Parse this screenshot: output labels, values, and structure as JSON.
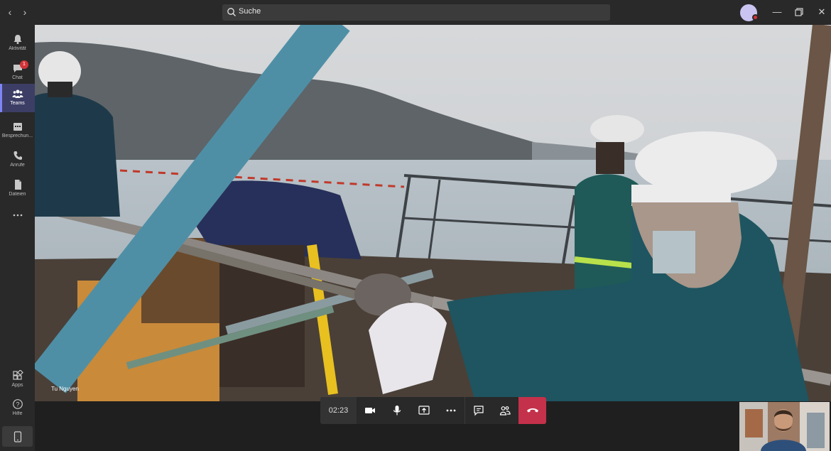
{
  "titlebar": {
    "search_placeholder": "Suche",
    "back_icon": "chevron-left-icon",
    "forward_icon": "chevron-right-icon",
    "minimize_icon": "minimize-icon",
    "restore_icon": "restore-icon",
    "close_icon": "close-icon"
  },
  "sidebar": {
    "items": [
      {
        "label": "Aktivität",
        "icon": "bell-icon"
      },
      {
        "label": "Chat",
        "icon": "chat-icon",
        "badge": "1"
      },
      {
        "label": "Teams",
        "icon": "teams-icon",
        "active": true
      },
      {
        "label": "Besprechun...",
        "icon": "calendar-icon"
      },
      {
        "label": "Anrufe",
        "icon": "phone-icon"
      },
      {
        "label": "Dateien",
        "icon": "file-icon"
      },
      {
        "label": "",
        "icon": "more-icon"
      }
    ],
    "bottom_items": [
      {
        "label": "Apps",
        "icon": "apps-icon"
      },
      {
        "label": "Hilfe",
        "icon": "help-icon"
      }
    ]
  },
  "call": {
    "participant_name": "Tu Nguyen",
    "timer": "02:23"
  },
  "colors": {
    "hangup": "#c4314b",
    "accent": "#7f85f5",
    "badge": "#d13438"
  }
}
